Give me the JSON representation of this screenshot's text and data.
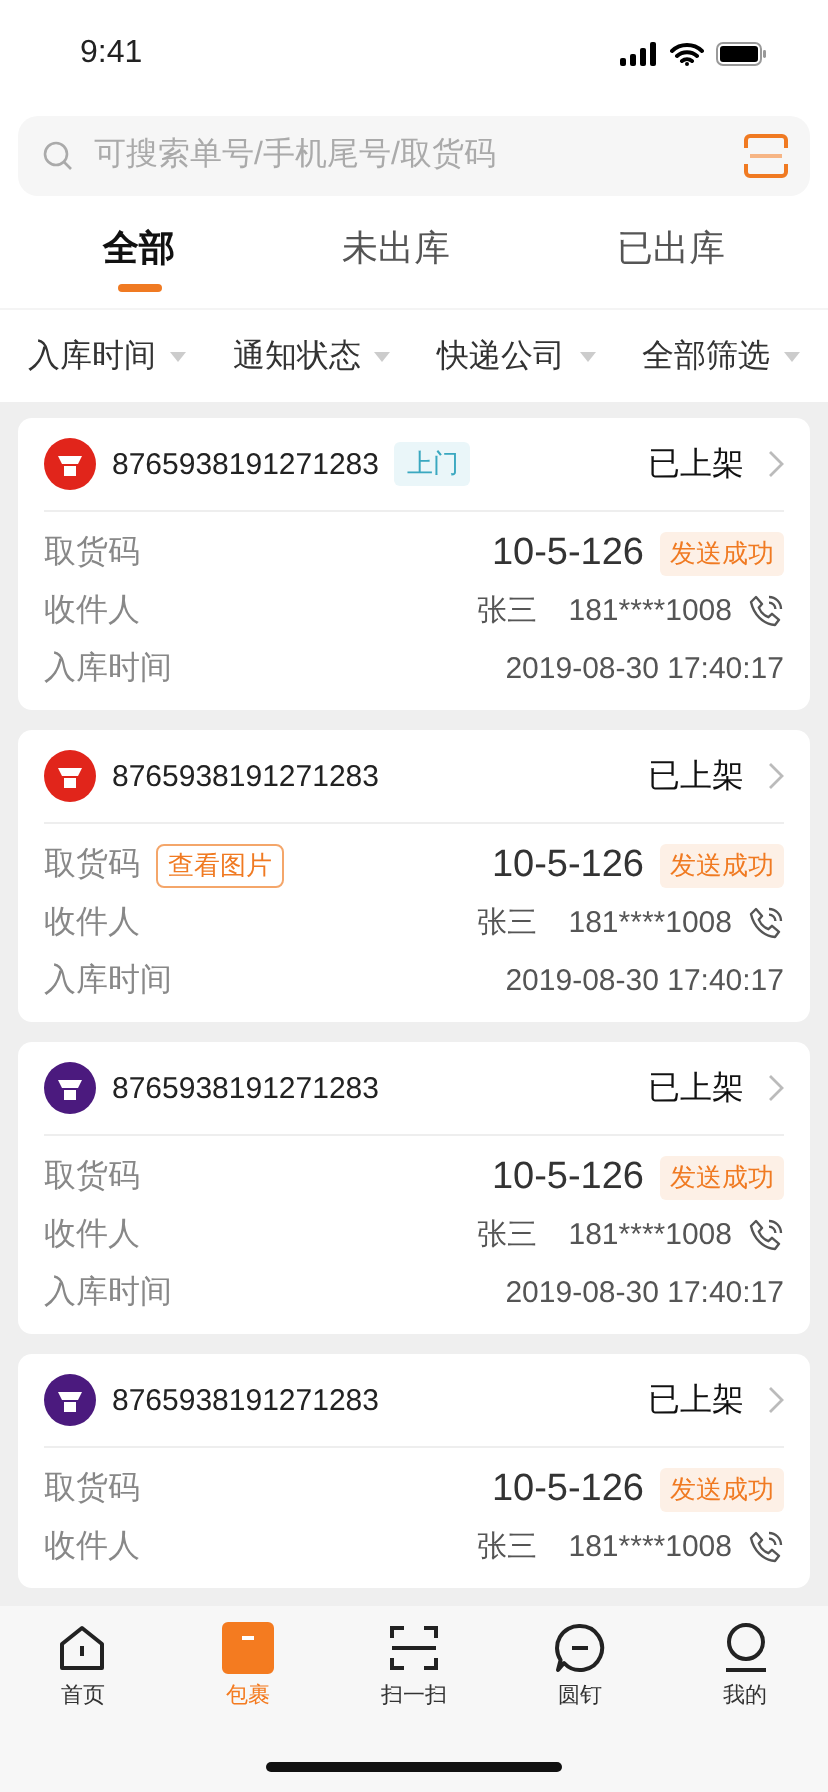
{
  "status_bar": {
    "time": "9:41"
  },
  "search": {
    "placeholder": "可搜索单号/手机尾号/取货码"
  },
  "tabs": [
    {
      "label": "全部",
      "selected": true
    },
    {
      "label": "未出库",
      "selected": false
    },
    {
      "label": "已出库",
      "selected": false
    }
  ],
  "filters": [
    "入库时间",
    "通知状态",
    "快递公司",
    "全部筛选"
  ],
  "cards": [
    {
      "color": "#e1251b",
      "tracking": "8765938191271283",
      "tag": "上门",
      "shelf_status": "已上架",
      "pickup_label": "取货码",
      "pickup_code": "10-5-126",
      "notify_status": "发送成功",
      "recipient_label": "收件人",
      "recipient_name": "张三",
      "phone": "181****1008",
      "time_label": "入库时间",
      "time": "2019-08-30 17:40:17"
    },
    {
      "color": "#e1251b",
      "tracking": "8765938191271283",
      "shelf_status": "已上架",
      "pickup_label": "取货码",
      "view_image": "查看图片",
      "pickup_code": "10-5-126",
      "notify_status": "发送成功",
      "recipient_label": "收件人",
      "recipient_name": "张三",
      "phone": "181****1008",
      "time_label": "入库时间",
      "time": "2019-08-30 17:40:17"
    },
    {
      "color": "#4b1a7e",
      "tracking": "8765938191271283",
      "shelf_status": "已上架",
      "pickup_label": "取货码",
      "pickup_code": "10-5-126",
      "notify_status": "发送成功",
      "recipient_label": "收件人",
      "recipient_name": "张三",
      "phone": "181****1008",
      "time_label": "入库时间",
      "time": "2019-08-30 17:40:17"
    },
    {
      "color": "#4b1a7e",
      "tracking": "8765938191271283",
      "shelf_status": "已上架",
      "pickup_label": "取货码",
      "pickup_code": "10-5-126",
      "notify_status": "发送成功",
      "recipient_label": "收件人",
      "recipient_name": "张三",
      "phone": "181****1008"
    }
  ],
  "nav": [
    {
      "kind": "home",
      "label": "首页",
      "selected": false
    },
    {
      "kind": "parcel",
      "label": "包裹",
      "selected": true
    },
    {
      "kind": "scan",
      "label": "扫一扫",
      "selected": false
    },
    {
      "kind": "pin",
      "label": "圆钉",
      "selected": false
    },
    {
      "kind": "me",
      "label": "我的",
      "selected": false
    }
  ]
}
